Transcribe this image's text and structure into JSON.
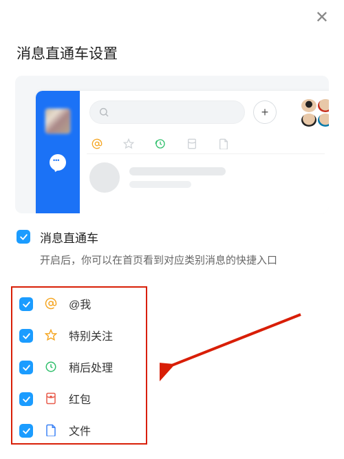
{
  "close_glyph": "✕",
  "title": "消息直通车设置",
  "master": {
    "label": "消息直通车",
    "description": "开启后，你可以在首页看到对应类别消息的快捷入口",
    "checked": true
  },
  "options": [
    {
      "key": "at",
      "label": "@我",
      "checked": true,
      "icon": "at-icon",
      "color": "#f5a623"
    },
    {
      "key": "star",
      "label": "特别关注",
      "checked": true,
      "icon": "star-icon",
      "color": "#f5a623"
    },
    {
      "key": "later",
      "label": "稍后处理",
      "checked": true,
      "icon": "clock-icon",
      "color": "#2fbf6b"
    },
    {
      "key": "redpkt",
      "label": "红包",
      "checked": true,
      "icon": "redpacket-icon",
      "color": "#e85b4b"
    },
    {
      "key": "file",
      "label": "文件",
      "checked": true,
      "icon": "file-icon",
      "color": "#3b82f6"
    }
  ],
  "preview": {
    "search_placeholder": "",
    "icon_row": [
      "at-icon",
      "star-icon",
      "clock-icon",
      "redpacket-icon",
      "file-icon"
    ]
  }
}
